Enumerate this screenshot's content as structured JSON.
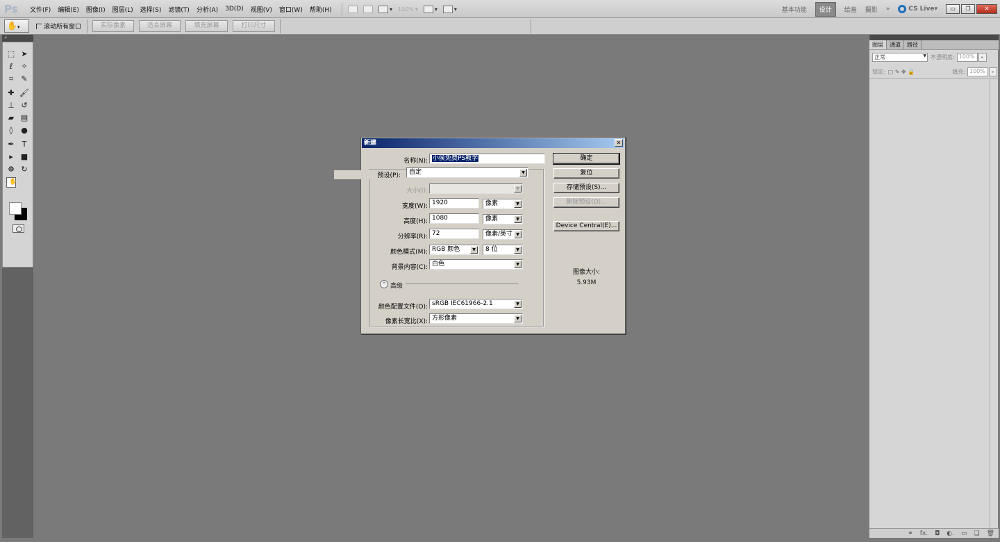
{
  "app": {
    "logo": "Ps",
    "menus": [
      "文件(F)",
      "编辑(E)",
      "图像(I)",
      "图层(L)",
      "选择(S)",
      "滤镜(T)",
      "分析(A)",
      "3D(D)",
      "视图(V)",
      "窗口(W)",
      "帮助(H)"
    ],
    "zoom": "100%",
    "workspaces": [
      "基本功能",
      "设计",
      "绘画",
      "摄影",
      "»"
    ],
    "active_workspace": "设计",
    "cs_live": "CS Live▾"
  },
  "options_bar": {
    "scroll_all_windows": "滚动所有窗口",
    "buttons": [
      "实际像素",
      "适合屏幕",
      "填充屏幕",
      "打印尺寸"
    ]
  },
  "right_panel": {
    "tabs": [
      "图层",
      "通道",
      "路径"
    ],
    "blend_mode": "正常",
    "opacity_label": "不透明度:",
    "opacity_value": "100%",
    "lock_label": "锁定:",
    "fill_label": "填充:",
    "fill_value": "100%"
  },
  "dialog": {
    "title": "新建",
    "name_label": "名称(N):",
    "name_value": "小侯免费PS教学",
    "preset_label": "预设(P):",
    "preset_value": "自定",
    "size_label": "大小(I):",
    "width_label": "宽度(W):",
    "width_value": "1920",
    "width_unit": "像素",
    "height_label": "高度(H):",
    "height_value": "1080",
    "height_unit": "像素",
    "resolution_label": "分辨率(R):",
    "resolution_value": "72",
    "resolution_unit": "像素/英寸",
    "color_mode_label": "颜色模式(M):",
    "color_mode_value": "RGB 颜色",
    "bit_depth_value": "8 位",
    "background_label": "背景内容(C):",
    "background_value": "白色",
    "advanced_label": "高级",
    "color_profile_label": "颜色配置文件(O):",
    "color_profile_value": "sRGB IEC61966-2.1",
    "pixel_aspect_label": "像素长宽比(X):",
    "pixel_aspect_value": "方形像素",
    "ok": "确定",
    "reset": "复位",
    "save_preset": "存储预设(S)...",
    "delete_preset": "删除预设(D)...",
    "device_central": "Device Central(E)...",
    "image_size_label": "图像大小:",
    "image_size_value": "5.93M"
  }
}
